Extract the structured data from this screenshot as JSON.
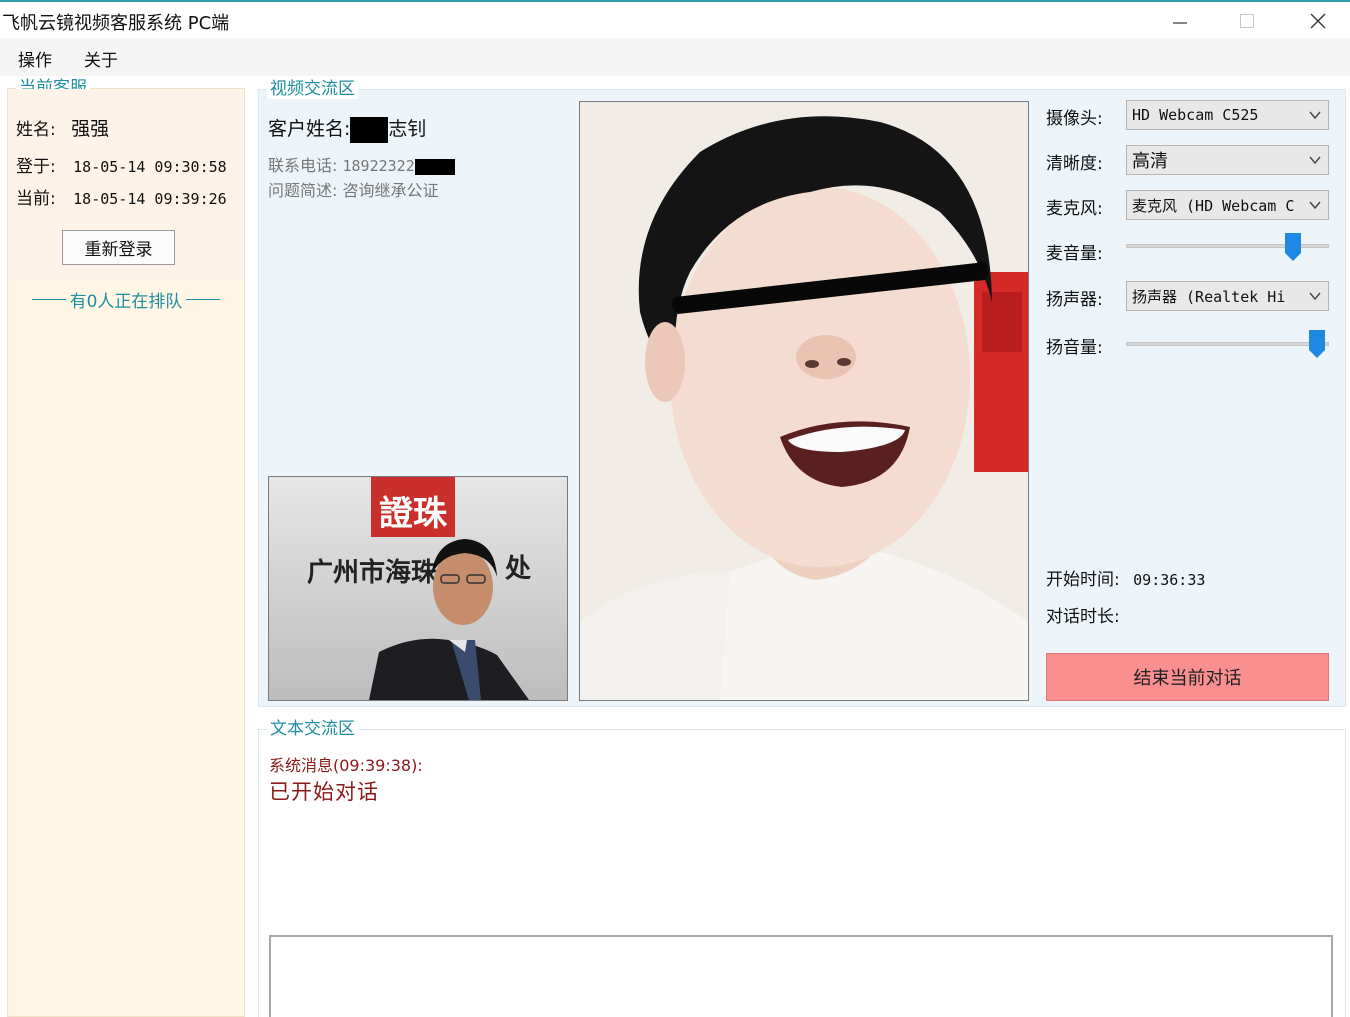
{
  "window": {
    "title": "飞帆云镜视频客服系统 PC端",
    "minimize_glyph": "—",
    "maximize_glyph": "☐",
    "close_glyph": "✕"
  },
  "menu": [
    "操作",
    "关于"
  ],
  "agent_panel": {
    "title": "当前客服",
    "name_label": "姓名:",
    "name_value": "强强",
    "login_label": "登于:",
    "login_value": "18-05-14 09:30:58",
    "current_label": "当前:",
    "current_value": "18-05-14 09:39:26",
    "relogin_button": "重新登录",
    "queue_text": "有0人正在排队"
  },
  "video_panel": {
    "title": "视频交流区",
    "customer_name_label": "客户姓名:",
    "customer_name_visible": "志钊",
    "phone_label": "联系电话:",
    "phone_value_visible": "18922322",
    "issue_label": "问题简述:",
    "issue_value": "咨询继承公证",
    "local_video_sign_text": "广州市海珠",
    "local_video_sign_suffix": "处",
    "local_video_logo_text": "證珠",
    "controls": {
      "camera_label": "摄像头:",
      "camera_value": "HD Webcam C525",
      "quality_label": "清晰度:",
      "quality_value": "高清",
      "mic_label": "麦克风:",
      "mic_value": "麦克风 (HD Webcam C",
      "mic_volume_label": "麦音量:",
      "mic_volume_level": 0.85,
      "speaker_label": "扬声器:",
      "speaker_value": "扬声器 (Realtek Hi",
      "speaker_volume_label": "扬音量:",
      "speaker_volume_level": 0.98
    },
    "start_time_label": "开始时间:",
    "start_time_value": "09:36:33",
    "duration_label": "对话时长:",
    "duration_value": "",
    "end_button": "结束当前对话",
    "end_button_color": "#f98f8f"
  },
  "text_panel": {
    "title": "文本交流区",
    "messages": [
      {
        "header": "系统消息(09:39:38):",
        "body": "已开始对话"
      }
    ],
    "message_color": "#8b1a1a"
  },
  "colors": {
    "accent": "#1e8fa0",
    "left_panel_bg": "#fff6e6",
    "video_panel_bg": "#edf5fa"
  }
}
